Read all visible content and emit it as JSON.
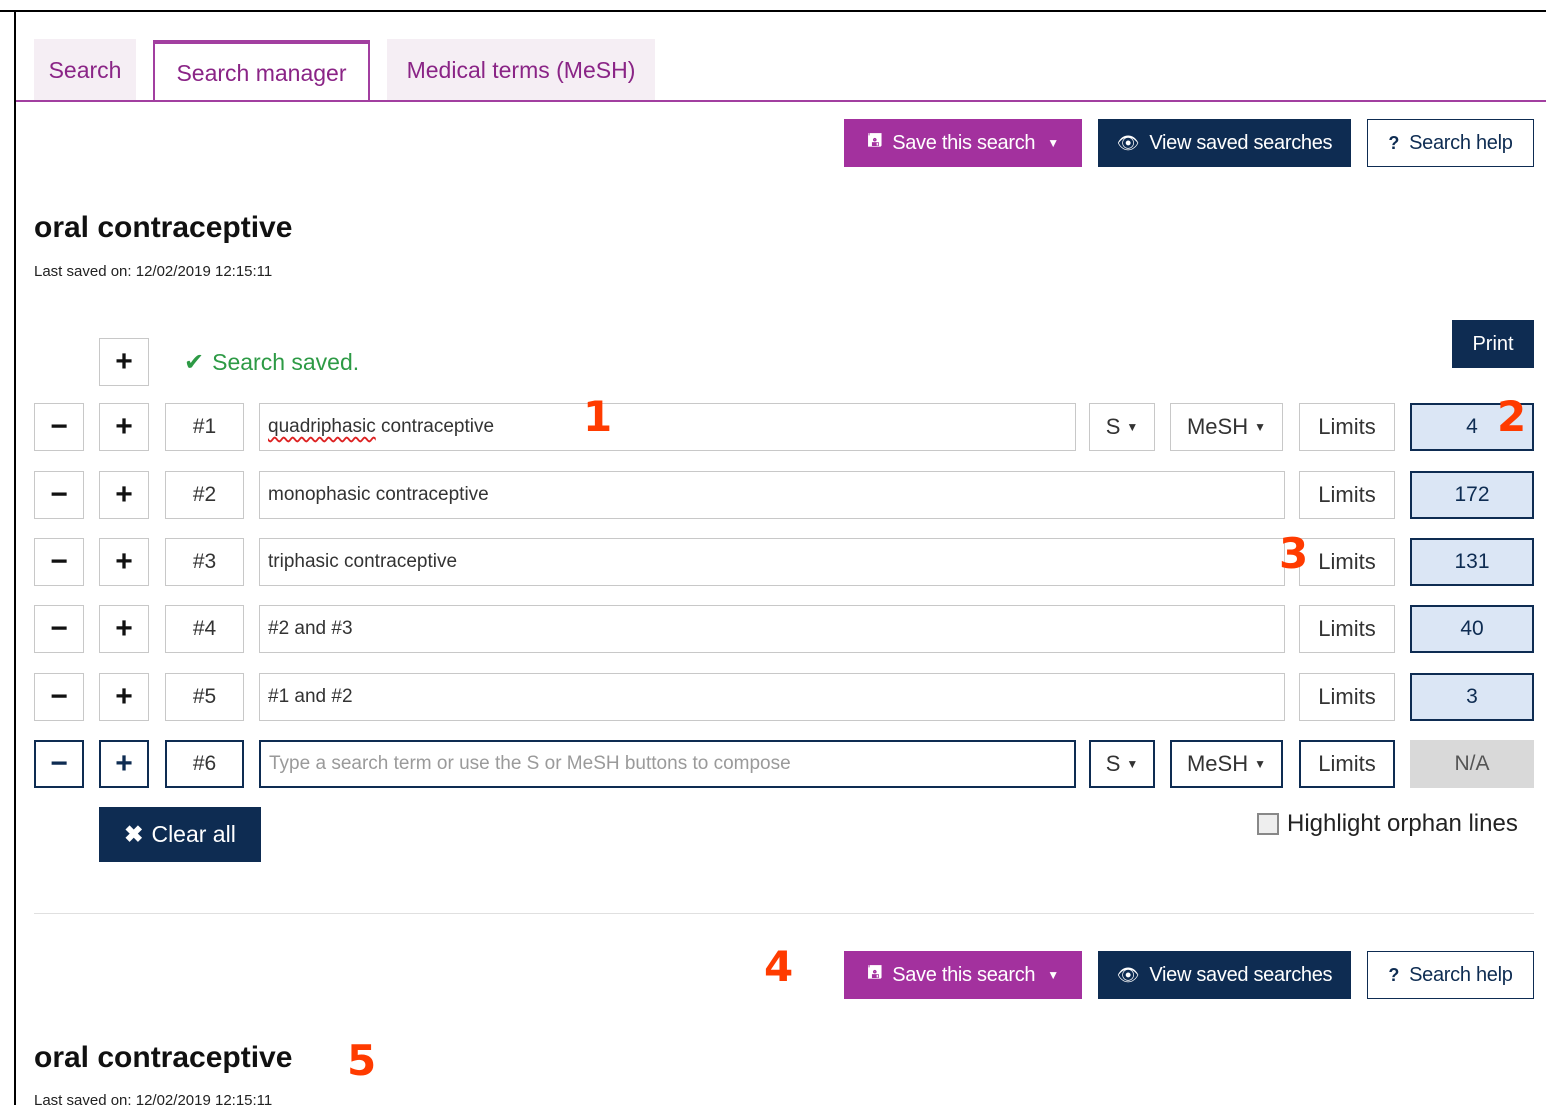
{
  "tabs": [
    {
      "label": "Search"
    },
    {
      "label": "Search manager"
    },
    {
      "label": "Medical terms (MeSH)"
    }
  ],
  "toolbar": {
    "save_label": "Save this search",
    "view_label": "View saved searches",
    "help_label": "Search help"
  },
  "search_title": "oral contraceptive",
  "last_saved": "Last saved on: 12/02/2019 12:15:11",
  "print_label": "Print",
  "status_text": "Search saved.",
  "rows": [
    {
      "num": "#1",
      "query": "contraceptive",
      "query_spelled": "quadriphasic",
      "s": "S",
      "mesh": "MeSH",
      "limits": "Limits",
      "count": "4"
    },
    {
      "num": "#2",
      "query": "monophasic contraceptive",
      "limits": "Limits",
      "count": "172"
    },
    {
      "num": "#3",
      "query": "triphasic contraceptive",
      "limits": "Limits",
      "count": "131"
    },
    {
      "num": "#4",
      "query": "#2 and #3",
      "limits": "Limits",
      "count": "40"
    },
    {
      "num": "#5",
      "query": "#1 and #2",
      "limits": "Limits",
      "count": "3"
    },
    {
      "num": "#6",
      "placeholder": "Type a search term or use the S or MeSH buttons to compose",
      "s": "S",
      "mesh": "MeSH",
      "limits": "Limits",
      "count": "N/A"
    }
  ],
  "clear_label": "Clear all",
  "orphan_label": "Highlight orphan lines",
  "markers": [
    "1",
    "2",
    "3",
    "4",
    "5"
  ],
  "colors": {
    "purple": "#a3319e",
    "navy": "#0e2c52",
    "success": "#2d9a45",
    "count_bg": "#dbe6f5",
    "marker": "#ff3b00"
  }
}
